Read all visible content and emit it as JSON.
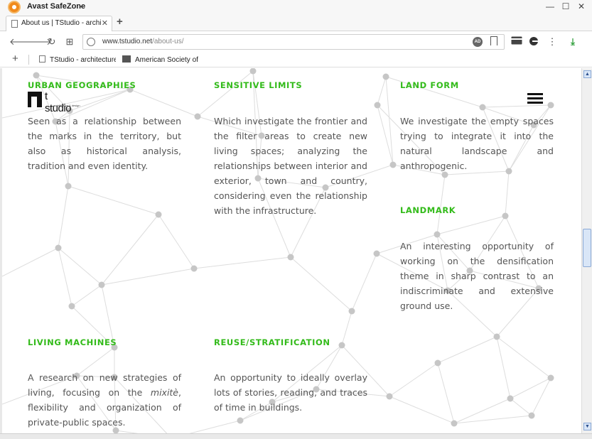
{
  "window": {
    "app_title": "Avast SafeZone",
    "controls": {
      "minimize": "—",
      "maximize": "☐",
      "close": "✕"
    }
  },
  "tabs": [
    {
      "title": "About us | TStudio - architecture",
      "close": "✕"
    }
  ],
  "newtab_label": "+",
  "nav": {
    "back": "🡐",
    "forward": "🡒",
    "reload": "↻",
    "apps": "⊞",
    "url_host": "www.tstudio.net",
    "url_path": "/about-us/",
    "ad_badge": "AD",
    "menu": "⋮",
    "download": "⤓"
  },
  "bookmarks": {
    "add": "+",
    "items": [
      {
        "label": "TStudio - architecture &"
      },
      {
        "label": "American Society of La"
      }
    ]
  },
  "site": {
    "logo_word": "t studio",
    "logo_tag": "architecture & design",
    "sections": [
      {
        "title": "URBAN GEOGRAPHIES",
        "text": "Seen as a relationship between the marks in the territory, but also as historical analysis, tradition and even identity."
      },
      {
        "title": "SENSITIVE LIMITS",
        "text": "Which investigate the frontier and the filter areas to create  new living spaces; analyzing the relationships between interior and exterior, town and country, considering even the relationship with the infrastructure."
      },
      {
        "title": "LAND FORM",
        "text": "We investigate the empty spaces trying to integrate it into the natural landscape and anthropogenic."
      },
      {
        "title": "LANDMARK",
        "text": "An interesting opportunity of working on the densification theme in sharp contrast to an indiscriminate and extensive ground use."
      },
      {
        "title": "LIVING MACHINES",
        "text_before": "A research on new strategies of living, focusing on the ",
        "text_em": "mixitè",
        "text_after": ", flexibility and organization of private-public spaces."
      },
      {
        "title": "REUSE/STRATIFICATION",
        "text": "An opportunity to ideally overlay lots of stories, reading, and traces of time in buildings."
      }
    ]
  },
  "colors": {
    "accent_green": "#33bb1a",
    "body_text": "#555555",
    "network_line": "#dddddd",
    "network_node": "#c6c6c6"
  },
  "icons": {
    "tab_page": "page-icon",
    "site_info": "site-info-icon",
    "menu": "hamburger-menu-icon"
  }
}
